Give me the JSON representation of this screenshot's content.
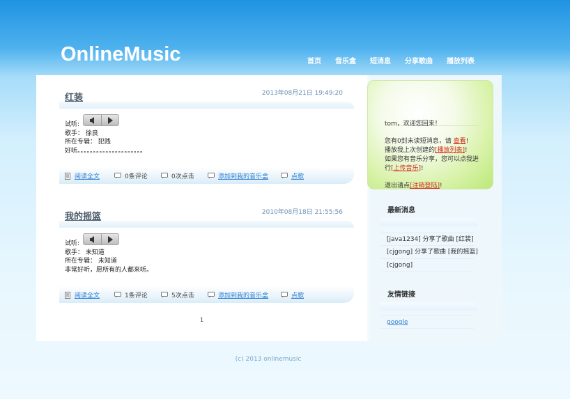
{
  "site": {
    "logo": "OnlineMusic"
  },
  "nav": [
    "首页",
    "音乐盒",
    "短消息",
    "分享歌曲",
    "播放列表"
  ],
  "posts": [
    {
      "title": "红装",
      "date": "2013年08月21日 19:49:20",
      "listen": "试听:",
      "singer": "歌手：  徐良",
      "album": "所在专辑：  犯贱",
      "desc": "好听。。。。。。。。。。。。。。。。。。。。。",
      "read_full": "阅读全文",
      "comments": "0条评论",
      "clicks": "0次点击",
      "add_to_box": "添加到我的音乐盒",
      "like": "点歌"
    },
    {
      "title": "我的摇篮",
      "date": "2010年08月18日 21:55:56",
      "listen": "试听:",
      "singer": "歌手：  未知道",
      "album": "所在专辑：  未知道",
      "desc": "非常好听，愿所有的人都来听。",
      "read_full": "阅读全文",
      "comments": "1条评论",
      "clicks": "5次点击",
      "add_to_box": "添加到我的音乐盒",
      "like": "点歌"
    }
  ],
  "pagination": {
    "current": "1"
  },
  "sidebar": {
    "welcome": "tom，欢迎您回来！",
    "unread_prefix": "您有0封未读短消息，请 ",
    "unread_link": "查看",
    "unread_suffix": "!",
    "playlist_prefix": "播放我上次创建的",
    "playlist_link": "[播放列表]",
    "playlist_suffix": "!",
    "share_line": "如果您有音乐分享，您可以点我进",
    "share_prefix": "行",
    "share_link": "[上传音乐]",
    "share_suffix": "!",
    "logout_prefix": "退出请点",
    "logout_link": "[注销登陆]",
    "logout_suffix": "!",
    "news_title": "最新消息",
    "news": [
      "[java1234] 分享了歌曲 [红装]",
      "[cjgong] 分享了歌曲 [我的摇篮]",
      "[cjgong]"
    ],
    "links_title": "友情链接",
    "links": [
      "google"
    ]
  },
  "footer": "(c) 2013 onlinemusic"
}
